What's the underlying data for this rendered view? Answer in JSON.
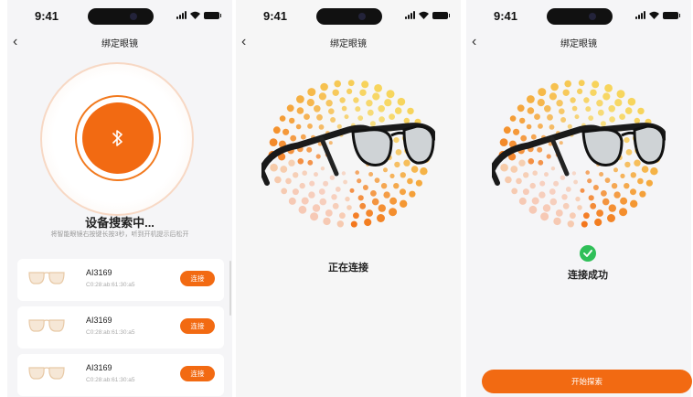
{
  "status": {
    "time": "9:41"
  },
  "screen1": {
    "title": "绑定眼镜",
    "searching": "设备搜索中...",
    "hint": "将智能眼镜右按键长按3秒，听到开机提示后松开",
    "devices": [
      {
        "name": "AI3169",
        "mac": "C0:28:ab:61:30:a5",
        "button": "连接"
      },
      {
        "name": "AI3169",
        "mac": "C0:28:ab:61:30:a5",
        "button": "连接"
      },
      {
        "name": "AI3169",
        "mac": "C0:28:ab:61:30:a5",
        "button": "连接"
      }
    ]
  },
  "screen2": {
    "title": "绑定眼镜",
    "status": "正在连接"
  },
  "screen3": {
    "title": "绑定眼镜",
    "status": "连接成功",
    "button": "开始探索"
  },
  "colors": {
    "accent": "#f26a12",
    "success": "#2fbf58"
  },
  "icons": [
    "back-icon",
    "bluetooth-icon",
    "glasses-icon",
    "check-icon"
  ]
}
